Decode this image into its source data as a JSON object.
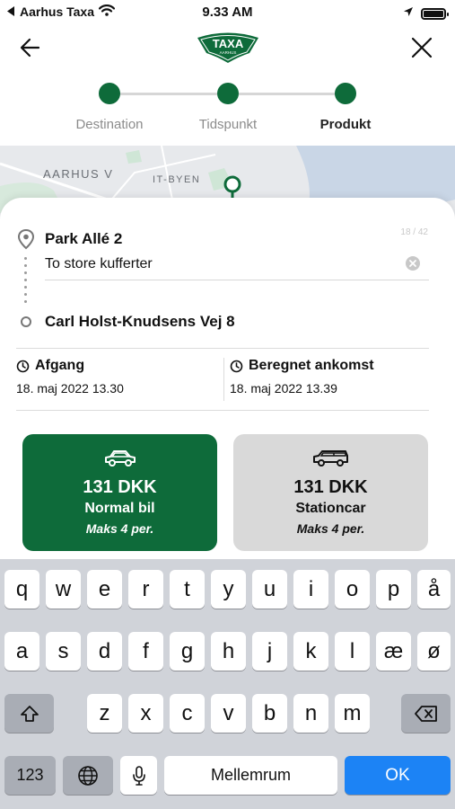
{
  "status_bar": {
    "carrier": "Aarhus Taxa",
    "time": "9.33 AM"
  },
  "header": {
    "logo_text": "TAXA",
    "logo_sub": "AARHUS"
  },
  "stepper": {
    "steps": [
      {
        "label": "Destination",
        "active": false
      },
      {
        "label": "Tidspunkt",
        "active": false
      },
      {
        "label": "Produkt",
        "active": true
      }
    ]
  },
  "map": {
    "labels": [
      "AARHUS V",
      "IT-BYEN"
    ]
  },
  "trip": {
    "pickup": "Park Allé 2",
    "note_value": "To store kufferter",
    "note_counter": "18 / 42",
    "destination": "Carl Holst-Knudsens Vej 8",
    "departure_label": "Afgang",
    "departure_time": "18. maj 2022 13.30",
    "arrival_label": "Beregnet ankomst",
    "arrival_time": "18. maj 2022 13.39"
  },
  "products": [
    {
      "price": "131 DKK",
      "name": "Normal bil",
      "capacity": "Maks 4 per.",
      "icon": "car-icon",
      "selected": true
    },
    {
      "price": "131 DKK",
      "name": "Stationcar",
      "capacity": "Maks 4 per.",
      "icon": "station-wagon-icon",
      "selected": false
    }
  ],
  "keyboard": {
    "row1": [
      "q",
      "w",
      "e",
      "r",
      "t",
      "y",
      "u",
      "i",
      "o",
      "p",
      "å"
    ],
    "row2": [
      "a",
      "s",
      "d",
      "f",
      "g",
      "h",
      "j",
      "k",
      "l",
      "æ",
      "ø"
    ],
    "row3": [
      "z",
      "x",
      "c",
      "v",
      "b",
      "n",
      "m"
    ],
    "numbers_key": "123",
    "space_key": "Mellemrum",
    "ok_key": "OK"
  },
  "colors": {
    "brand_green": "#0e6b3a",
    "ok_blue": "#1c83f5"
  }
}
